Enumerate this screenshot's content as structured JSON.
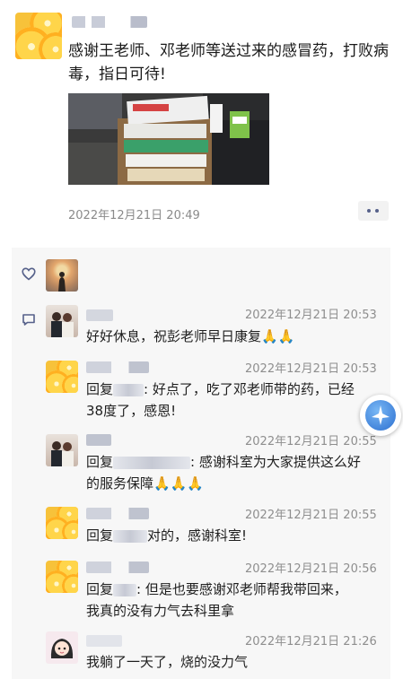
{
  "post": {
    "text": "感谢王老师、邓老师等送过来的感冒药，打败病毒，指日可待!",
    "time": "2022年12月21日 20:49"
  },
  "comments": [
    {
      "time": "2022年12月21日 20:53",
      "line1": "好好休息，祝彭老师早日康复",
      "emoji": "🙏🙏",
      "line2": ""
    },
    {
      "time": "2022年12月21日 20:53",
      "prefix": "回复",
      "line1": ": 好点了，吃了邓老师带的药，已经",
      "line2": "38度了，感恩!"
    },
    {
      "time": "2022年12月21日 20:55",
      "prefix": "回复",
      "line1": ": 感谢科室为大家提供这么好",
      "line2": "的服务保障",
      "emoji2": "🙏🙏🙏"
    },
    {
      "time": "2022年12月21日 20:55",
      "prefix": "回复",
      "line1": "对的，感谢科室!",
      "line2": ""
    },
    {
      "time": "2022年12月21日 20:56",
      "prefix": "回复",
      "line1": ": 但是也要感谢邓老师帮我带回来，",
      "line2": "我真的没有力气去科里拿"
    },
    {
      "time": "2022年12月21日 21:26",
      "line1": "我躺了一天了，烧的没力气",
      "line2": ""
    }
  ],
  "icons": {
    "like": "heart-outline-icon",
    "comment": "comment-bubble-icon",
    "more": "more-dots-icon",
    "floating": "assistive-touch-icon"
  },
  "colors": {
    "link": "#56618a",
    "panel": "#f7f7f7",
    "time": "#8a8a8a"
  }
}
